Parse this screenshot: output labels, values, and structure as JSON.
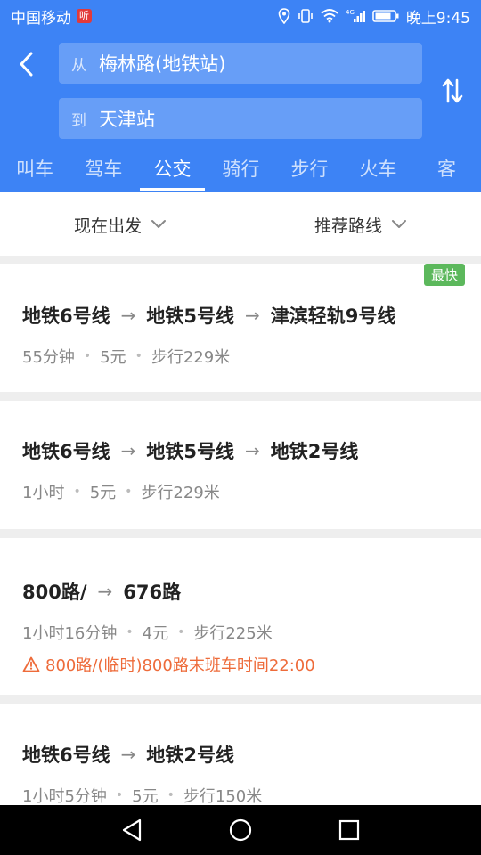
{
  "status_bar": {
    "carrier": "中国移动",
    "badge": "听",
    "network": "4G",
    "time": "晚上9:45"
  },
  "header": {
    "from_prefix": "从",
    "from_value": "梅林路(地铁站)",
    "to_prefix": "到",
    "to_value": "天津站"
  },
  "tabs": [
    {
      "label": "叫车"
    },
    {
      "label": "驾车"
    },
    {
      "label": "公交"
    },
    {
      "label": "骑行"
    },
    {
      "label": "步行"
    },
    {
      "label": "火车"
    },
    {
      "label": "客"
    }
  ],
  "filters": {
    "departure": "现在出发",
    "sort": "推荐路线"
  },
  "routes": [
    {
      "badge": "最快",
      "segments": [
        "地铁6号线",
        "地铁5号线",
        "津滨轻轨9号线"
      ],
      "duration": "55分钟",
      "price": "5元",
      "walk": "步行229米"
    },
    {
      "segments": [
        "地铁6号线",
        "地铁5号线",
        "地铁2号线"
      ],
      "duration": "1小时",
      "price": "5元",
      "walk": "步行229米"
    },
    {
      "segments": [
        "800路/",
        "676路"
      ],
      "duration": "1小时16分钟",
      "price": "4元",
      "walk": "步行225米",
      "warning": "800路/(临时)800路末班车时间22:00"
    },
    {
      "segments": [
        "地铁6号线",
        "地铁2号线"
      ],
      "duration": "1小时5分钟",
      "price": "5元",
      "walk": "步行150米"
    }
  ],
  "colors": {
    "primary": "#3d83f5",
    "badge_green": "#5cb85c",
    "warning": "#ee6b3a"
  }
}
